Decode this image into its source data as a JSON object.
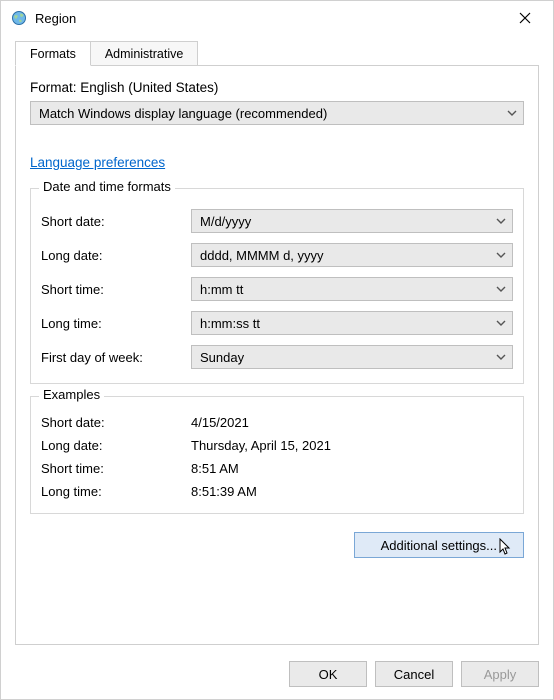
{
  "window": {
    "title": "Region",
    "icon": "globe-icon"
  },
  "tabs": {
    "formats": "Formats",
    "administrative": "Administrative"
  },
  "format": {
    "label_prefix": "Format: ",
    "current_language": "English (United States)",
    "selector_value": "Match Windows display language (recommended)"
  },
  "language_preferences_link": "Language preferences",
  "date_time_formats": {
    "legend": "Date and time formats",
    "short_date_label": "Short date:",
    "short_date_value": "M/d/yyyy",
    "long_date_label": "Long date:",
    "long_date_value": "dddd, MMMM d, yyyy",
    "short_time_label": "Short time:",
    "short_time_value": "h:mm tt",
    "long_time_label": "Long time:",
    "long_time_value": "h:mm:ss tt",
    "first_day_label": "First day of week:",
    "first_day_value": "Sunday"
  },
  "examples": {
    "legend": "Examples",
    "short_date_label": "Short date:",
    "short_date_value": "4/15/2021",
    "long_date_label": "Long date:",
    "long_date_value": "Thursday, April 15, 2021",
    "short_time_label": "Short time:",
    "short_time_value": "8:51 AM",
    "long_time_label": "Long time:",
    "long_time_value": "8:51:39 AM"
  },
  "buttons": {
    "additional_settings": "Additional settings...",
    "ok": "OK",
    "cancel": "Cancel",
    "apply": "Apply"
  }
}
